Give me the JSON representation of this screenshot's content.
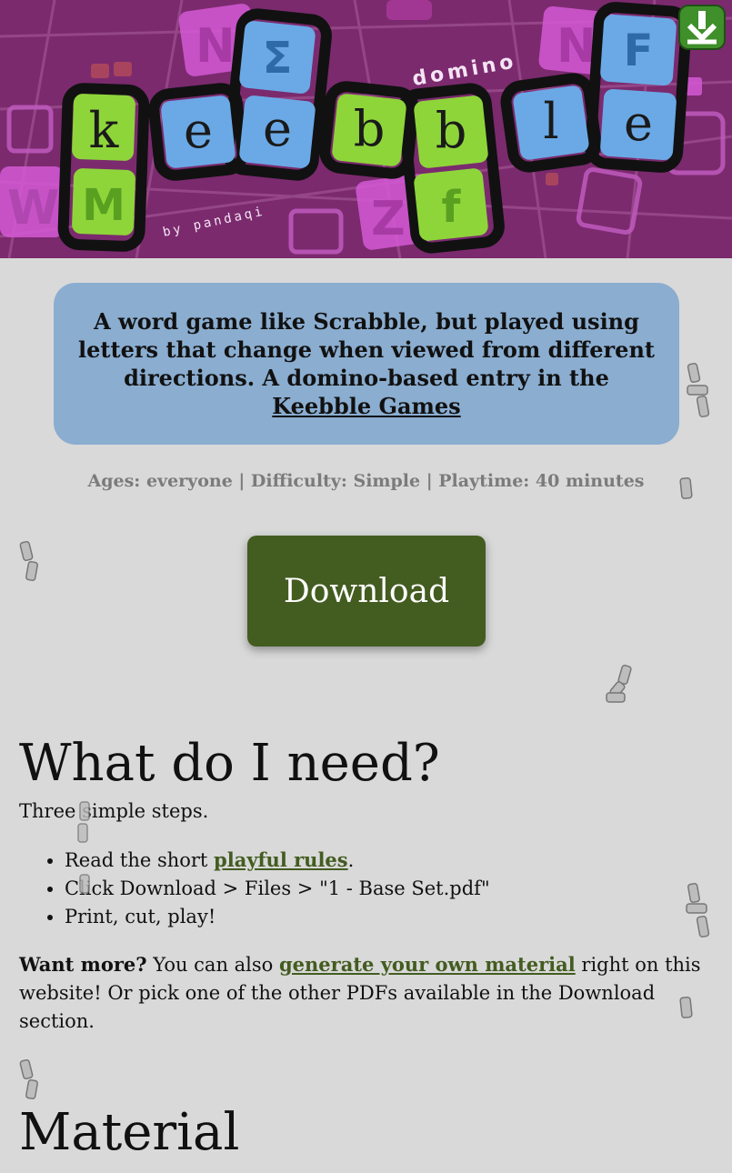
{
  "banner": {
    "logo_letters": [
      "k",
      "e",
      "e",
      "b",
      "b",
      "l",
      "e"
    ],
    "logo_letters_alt": [
      "M",
      "Σ",
      "f",
      "F"
    ],
    "subtitle": "domino",
    "byline": "by pandaqi",
    "colors": {
      "purple": "#7b2a6e",
      "green": "#8ed53a",
      "blue": "#6aa9e6",
      "pink": "#e26fe0"
    }
  },
  "corner": {
    "icon": "download-arrow-icon"
  },
  "intro": {
    "text": "A word game like Scrabble, but played using letters that change when viewed from different directions. A domino-based entry in the ",
    "link": "Keebble Games"
  },
  "meta": "Ages: everyone | Difficulty: Simple | Playtime: 40 minutes",
  "download_button": "Download",
  "section1": {
    "heading": "What do I need?",
    "intro": "Three simple steps.",
    "steps": [
      {
        "before": "Read the short ",
        "link": "playful rules",
        "after": "."
      },
      {
        "text": "Click Download > Files > \"1 - Base Set.pdf\""
      },
      {
        "text": "Print, cut, play!"
      }
    ],
    "more_bold": "Want more?",
    "more_text1": " You can also ",
    "more_link": "generate your own material",
    "more_text2": " right on this website! Or pick one of the other PDFs available in the Download section."
  },
  "section2": {
    "heading": "Material"
  }
}
